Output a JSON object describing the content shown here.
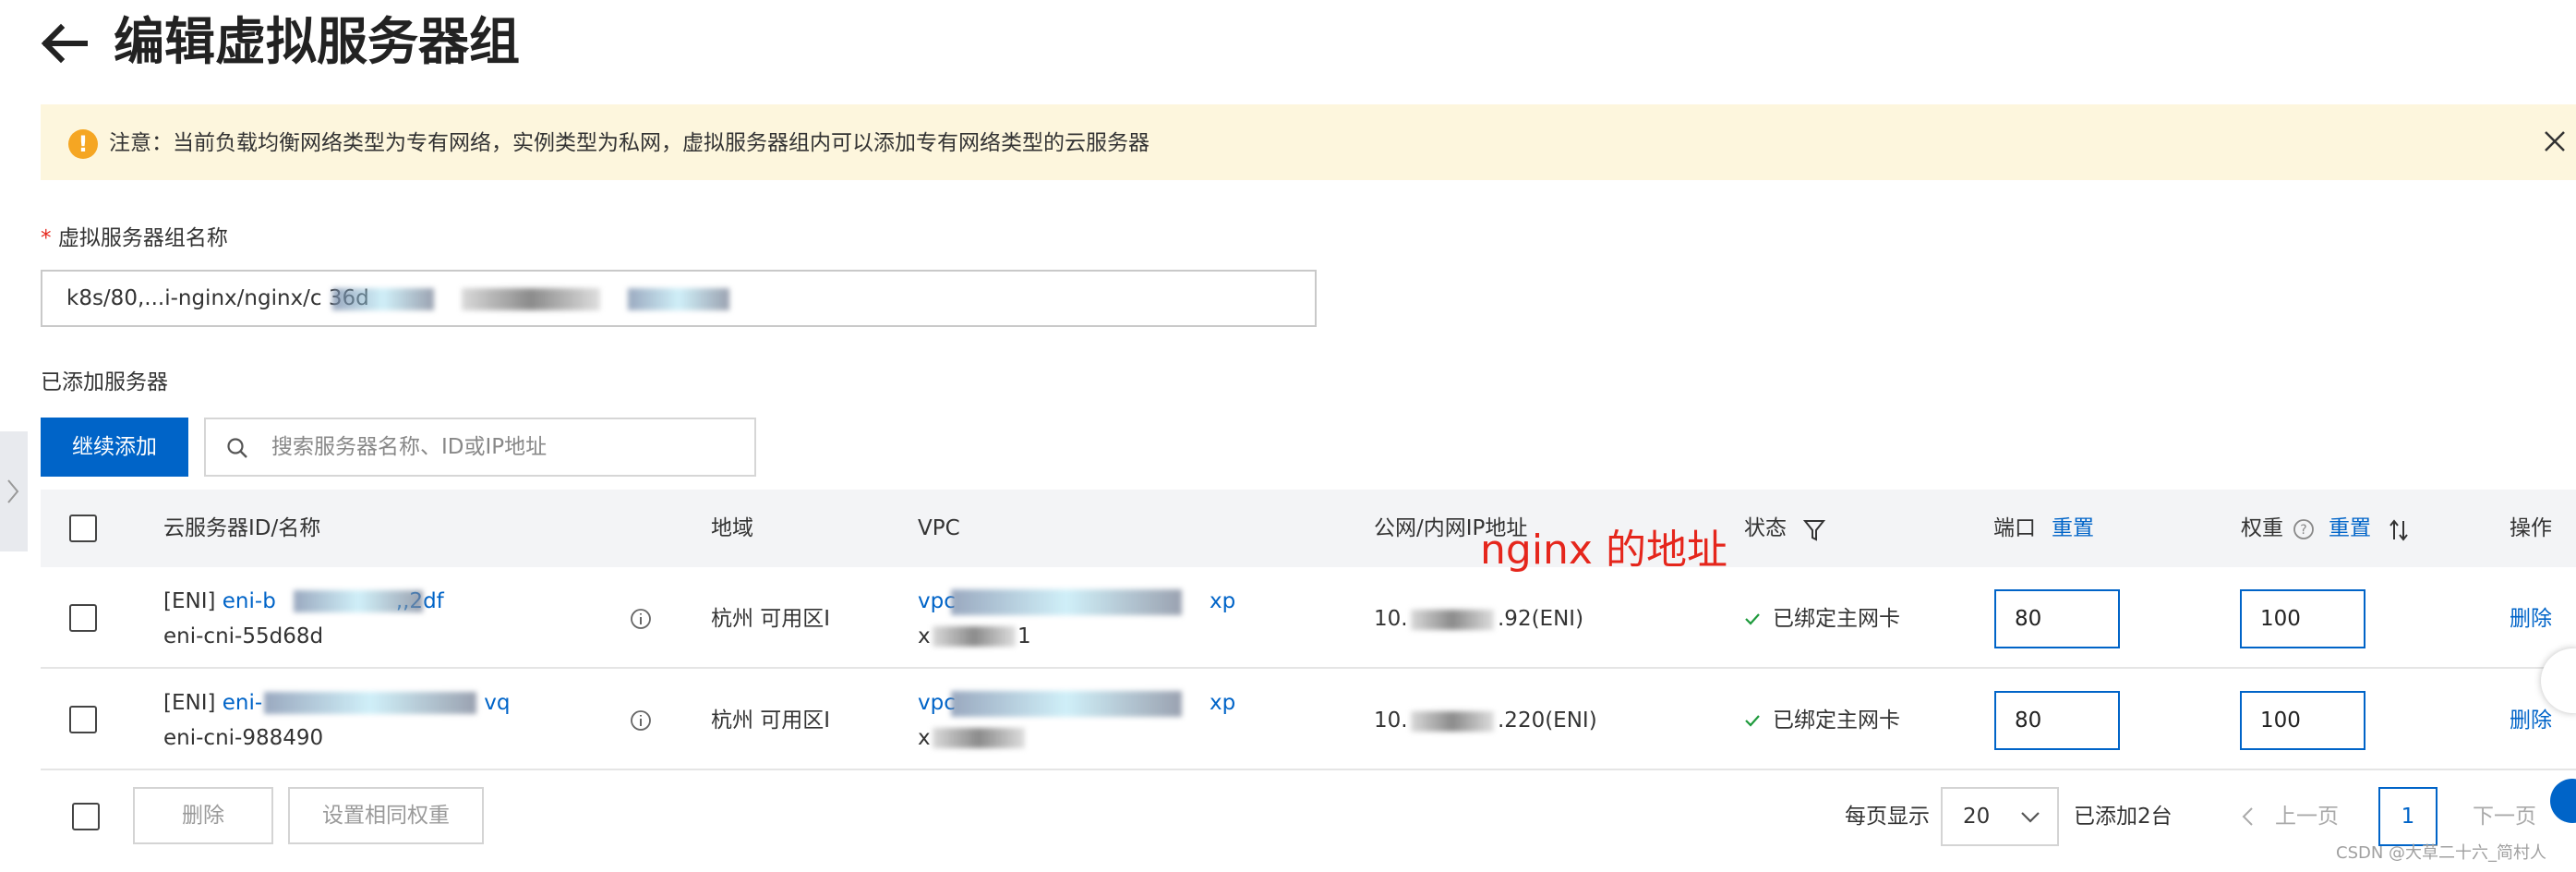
{
  "header": {
    "title": "编辑虚拟服务器组"
  },
  "notice": {
    "text": "注意：当前负载均衡网络类型为专有网络，实例类型为私网，虚拟服务器组内可以添加专有网络类型的云服务器"
  },
  "form": {
    "required_mark": "*",
    "group_name_label": "虚拟服务器组名称",
    "group_name_value": "k8s/80,...i-nginx/nginx/c                                        36d"
  },
  "servers": {
    "section_label": "已添加服务器",
    "add_button": "继续添加",
    "search_placeholder": "搜索服务器名称、ID或IP地址"
  },
  "table": {
    "columns": {
      "server": "云服务器ID/名称",
      "region": "地域",
      "vpc": "VPC",
      "ip": "公网/内网IP地址",
      "status": "状态",
      "port": "端口",
      "port_reset": "重置",
      "weight": "权重",
      "weight_reset": "重置",
      "action": "操作"
    },
    "rows": [
      {
        "eni_prefix": "[ENI]",
        "eni_link": "eni-b",
        "eni_link_tail": ",,2df",
        "eni_name": "eni-cni-55d68d",
        "region": "杭州 可用区I",
        "vpc_head": "vpc",
        "vpc_tail": "xp",
        "vpc_line2_a": "x",
        "vpc_line2_b": "1",
        "ip_head": "10.",
        "ip_tail": ".92(ENI)",
        "status": "已绑定主网卡",
        "port": "80",
        "weight": "100",
        "action": "删除"
      },
      {
        "eni_prefix": "[ENI]",
        "eni_link": "eni-",
        "eni_link_tail": "vq",
        "eni_name": "eni-cni-988490",
        "region": "杭州 可用区I",
        "vpc_head": "vpc",
        "vpc_tail": "xp",
        "vpc_line2_a": "x",
        "vpc_line2_b": "",
        "ip_head": "10.",
        "ip_tail": ".220(ENI)",
        "status": "已绑定主网卡",
        "port": "80",
        "weight": "100",
        "action": "删除"
      }
    ]
  },
  "footer": {
    "delete_button": "删除",
    "same_weight_button": "设置相同权重",
    "page_size_label": "每页显示",
    "page_size": "20",
    "added_count": "已添加2台",
    "prev": "上一页",
    "page": "1",
    "next": "下一页"
  },
  "annotation": "nginx 的地址",
  "watermark": "CSDN @大草二十六_简村人"
}
